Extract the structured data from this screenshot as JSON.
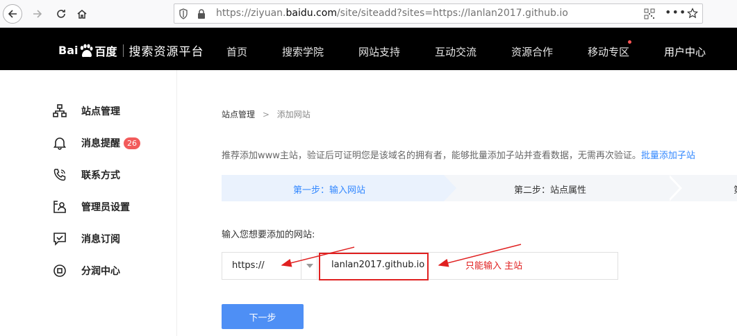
{
  "browser": {
    "url_prefix": "https://ziyuan.",
    "url_domain": "baidu.com",
    "url_suffix": "/site/siteadd?sites=https://lanlan2017.github.io",
    "more_label": "•••"
  },
  "header": {
    "logo_bai": "Bai",
    "logo_du": "百度",
    "platform_name": "搜索资源平台",
    "nav": [
      "首页",
      "搜索学院",
      "网站支持",
      "互动交流",
      "资源合作",
      "移动专区",
      "用户中心"
    ]
  },
  "sidebar": {
    "items": [
      {
        "label": "站点管理",
        "icon": "sitemap-icon"
      },
      {
        "label": "消息提醒",
        "icon": "bell-icon",
        "badge": "26"
      },
      {
        "label": "联系方式",
        "icon": "phone-icon"
      },
      {
        "label": "管理员设置",
        "icon": "admin-icon"
      },
      {
        "label": "消息订阅",
        "icon": "subscribe-icon"
      },
      {
        "label": "分润中心",
        "icon": "share-icon"
      }
    ]
  },
  "main": {
    "breadcrumb": {
      "root": "站点管理",
      "separator": ">",
      "current": "添加网站"
    },
    "tip_text": "推荐添加www主站，验证后可证明您是该域名的拥有者，能够批量添加子站并查看数据，无需再次验证。",
    "tip_link": "批量添加子站",
    "steps": [
      "第一步：输入网站",
      "第二步：站点属性",
      "第"
    ],
    "input_label": "输入您想要添加的网站:",
    "protocol_value": "https://",
    "site_value": "lanlan2017.github.io",
    "annotation": "只能输入 主站",
    "next_label": "下一步"
  },
  "colors": {
    "header_bg": "#000000",
    "accent": "#3388ff",
    "button": "#4e8ff5",
    "annotation_red": "#e02020",
    "badge": "#f25b5b"
  }
}
